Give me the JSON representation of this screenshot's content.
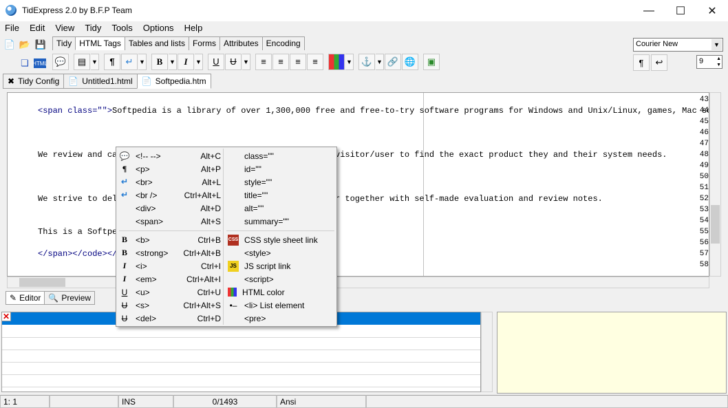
{
  "window": {
    "title": "TidExpress 2.0 by B.F.P Team"
  },
  "menu": [
    "File",
    "Edit",
    "View",
    "Tidy",
    "Tools",
    "Options",
    "Help"
  ],
  "toolbar_tabs": [
    "Tidy",
    "HTML Tags",
    "Tables and lists",
    "Forms",
    "Attributes",
    "Encoding"
  ],
  "active_toolbar_tab": "HTML Tags",
  "font": {
    "name": "Courier New",
    "size": "9"
  },
  "doc_tabs": [
    "Tidy Config",
    "Untitled1.html",
    "Softpedia.htm"
  ],
  "active_doc_tab": "Softpedia.htm",
  "editor": {
    "lines": [
      {
        "n": "43",
        "text": ""
      },
      {
        "n": "44",
        "tag": "<span class=\"\">",
        "text": "Softpedia is a library of over 1,300,000 free and free-to-try software programs for Windows and Unix/Linux, games, Mac softw"
      },
      {
        "n": "45",
        "text": ""
      },
      {
        "n": "46",
        "text": ""
      },
      {
        "n": "47",
        "text": ""
      },
      {
        "n": "48",
        "text": "We review and ca",
        "text2": "visitor/user to find the exact product they and their system needs."
      },
      {
        "n": "49",
        "text": ""
      },
      {
        "n": "50",
        "text": ""
      },
      {
        "n": "51",
        "text": ""
      },
      {
        "n": "52",
        "text": "We strive to del",
        "text2": "r together with self-made evaluation and review notes."
      },
      {
        "n": "53",
        "text": ""
      },
      {
        "n": "54",
        "text": ""
      },
      {
        "n": "55",
        "text": "This is a Softpe"
      },
      {
        "n": "56",
        "text": ""
      },
      {
        "n": "57",
        "tag": "</span></code></",
        "text": ""
      },
      {
        "n": "58",
        "text": ""
      }
    ]
  },
  "bottom_tabs": [
    "Editor",
    "Preview"
  ],
  "context_menu": {
    "left": [
      {
        "icon": "comment-icon",
        "label": "<!-- -->",
        "shortcut": "Alt+C"
      },
      {
        "icon": "pilcrow-icon",
        "label": "<p>",
        "shortcut": "Alt+P"
      },
      {
        "icon": "line-break-icon",
        "label": "<br>",
        "shortcut": "Alt+L"
      },
      {
        "icon": "line-break-icon",
        "label": "<br />",
        "shortcut": "Ctrl+Alt+L"
      },
      {
        "icon": "",
        "label": "<div>",
        "shortcut": "Alt+D"
      },
      {
        "icon": "",
        "label": "<span>",
        "shortcut": "Alt+S"
      },
      {
        "icon": "bold-icon",
        "label": "<b>",
        "shortcut": "Ctrl+B"
      },
      {
        "icon": "bold-icon",
        "label": "<strong>",
        "shortcut": "Ctrl+Alt+B"
      },
      {
        "icon": "italic-icon",
        "label": "<i>",
        "shortcut": "Ctrl+I"
      },
      {
        "icon": "italic-icon",
        "label": "<em>",
        "shortcut": "Ctrl+Alt+I"
      },
      {
        "icon": "underline-icon",
        "label": "<u>",
        "shortcut": "Ctrl+U"
      },
      {
        "icon": "strikethrough-icon",
        "label": "<s>",
        "shortcut": "Ctrl+Alt+S"
      },
      {
        "icon": "strikethrough-icon",
        "label": "<del>",
        "shortcut": "Ctrl+D"
      }
    ],
    "right": [
      {
        "icon": "",
        "label": "class=\"\""
      },
      {
        "icon": "",
        "label": "id=\"\""
      },
      {
        "icon": "",
        "label": "style=\"\""
      },
      {
        "icon": "",
        "label": "title=\"\""
      },
      {
        "icon": "",
        "label": "alt=\"\""
      },
      {
        "icon": "",
        "label": "summary=\"\""
      },
      {
        "icon": "css-icon",
        "label": "CSS style sheet link"
      },
      {
        "icon": "",
        "label": "<style>"
      },
      {
        "icon": "js-icon",
        "label": "JS script link"
      },
      {
        "icon": "",
        "label": "<script>"
      },
      {
        "icon": "color-grid-icon",
        "label": "HTML color"
      },
      {
        "icon": "list-element-icon",
        "label": "<li> List element"
      },
      {
        "icon": "",
        "label": "<pre>"
      }
    ]
  },
  "status": {
    "position": "1:  1",
    "mode": "INS",
    "count": "0/1493",
    "encoding": "Ansi"
  },
  "colors": {
    "selection": "#0078d7",
    "tag": "#000080",
    "notes_bg": "#ffffe1"
  }
}
